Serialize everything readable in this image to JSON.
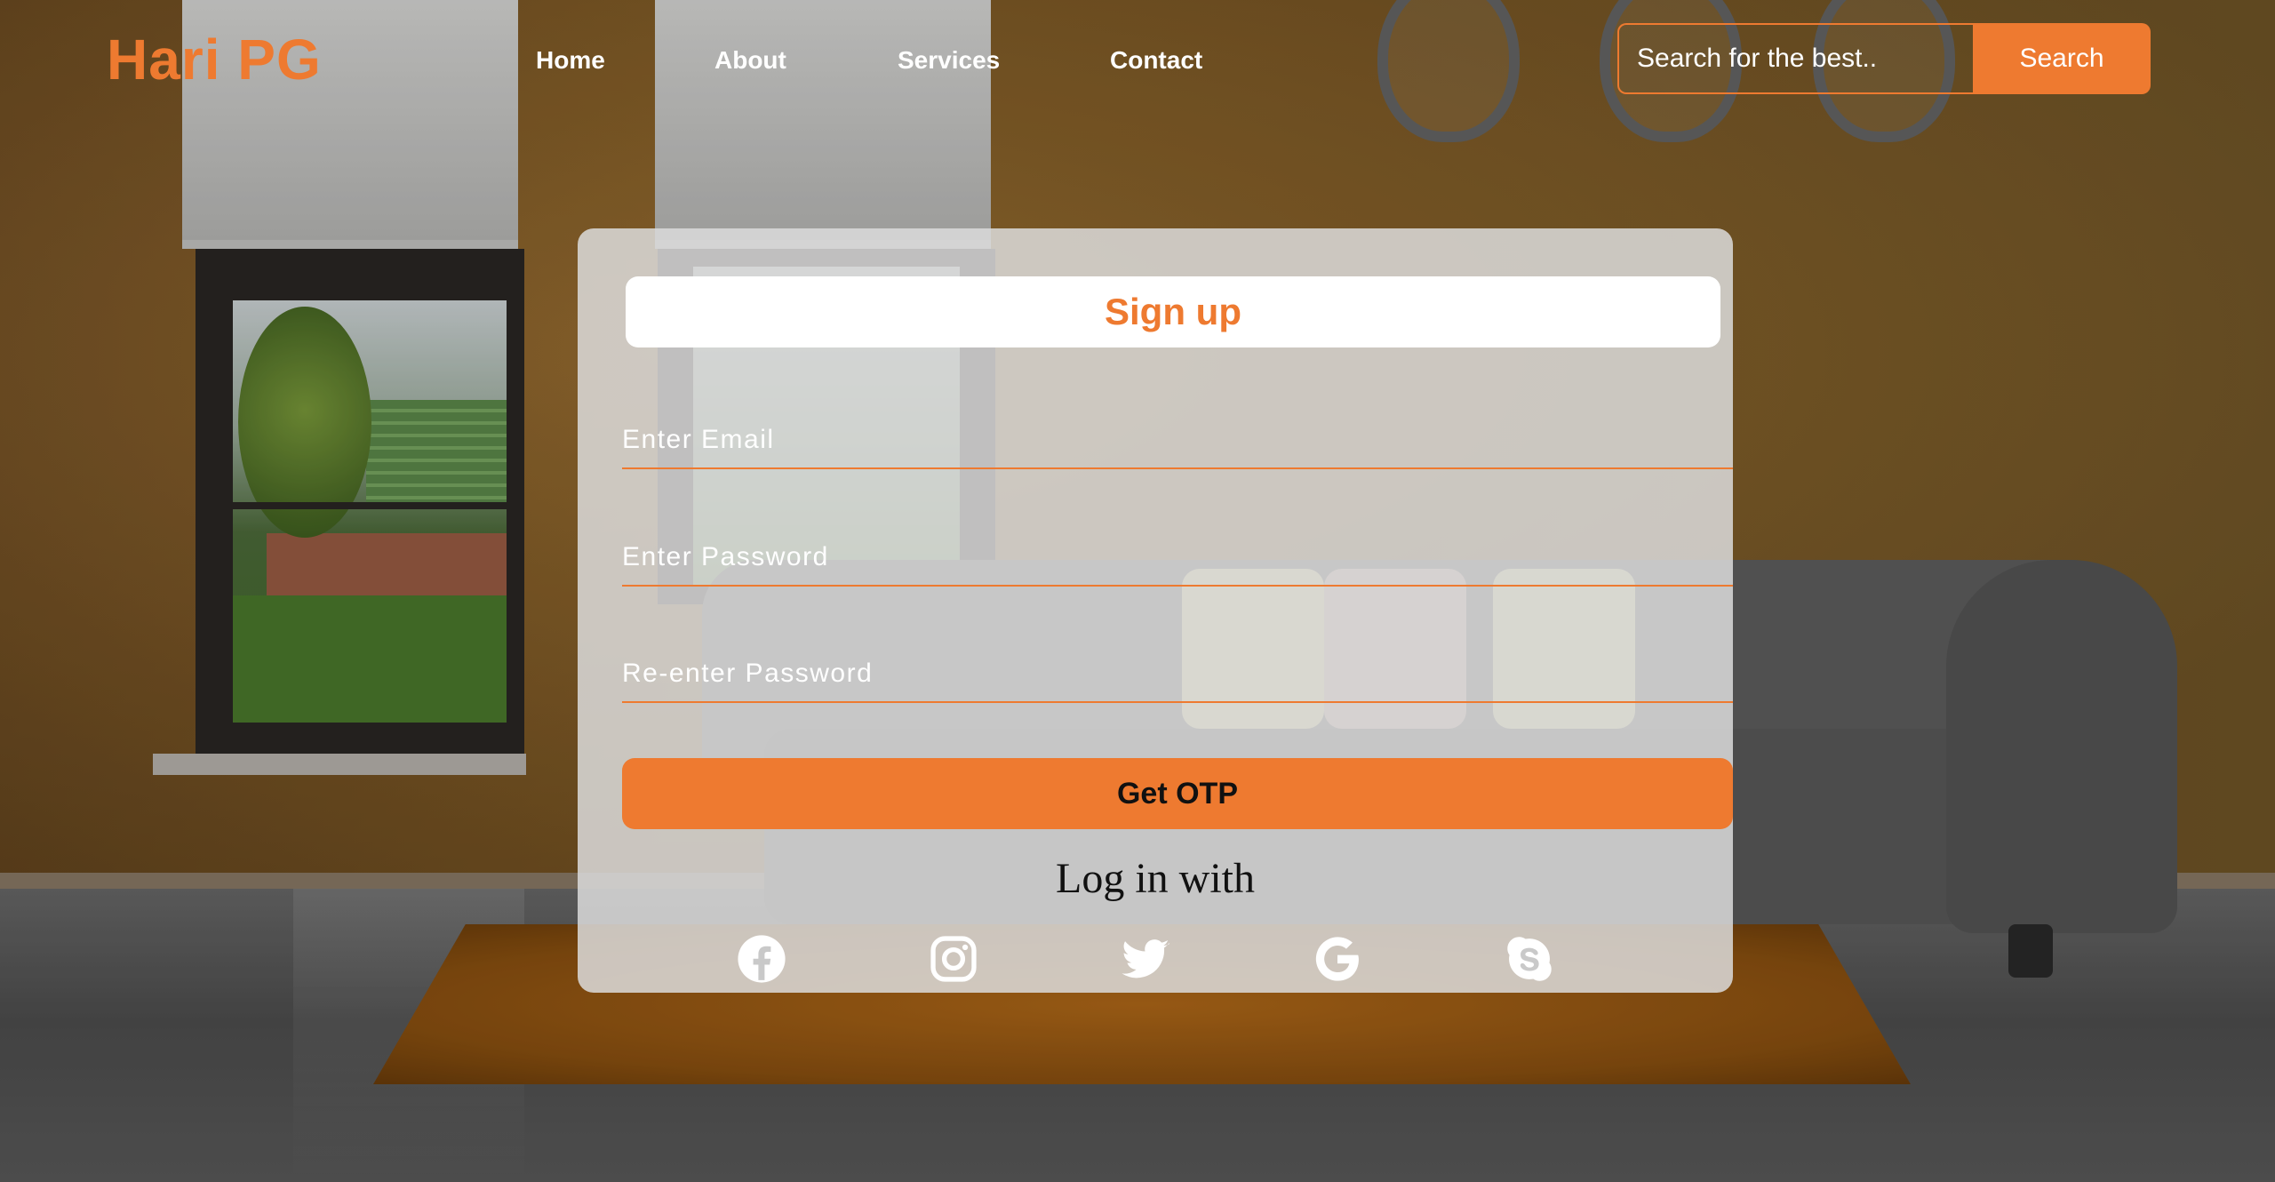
{
  "header": {
    "brand": "Hari PG",
    "nav": [
      {
        "label": "Home"
      },
      {
        "label": "About"
      },
      {
        "label": "Services"
      },
      {
        "label": "Contact"
      }
    ],
    "search": {
      "placeholder": "Search for the best..",
      "button_label": "Search"
    }
  },
  "signup": {
    "title": "Sign up",
    "email_placeholder": "Enter Email",
    "password_placeholder": "Enter Password",
    "reenter_placeholder": "Re-enter Password",
    "otp_button": "Get OTP",
    "login_with": "Log in with",
    "social_icons": [
      "facebook-icon",
      "instagram-icon",
      "twitter-icon",
      "google-icon",
      "skype-icon"
    ]
  },
  "colors": {
    "accent": "#ee7a30",
    "card_bg": "#dcdcdc",
    "text_dark": "#111111",
    "text_light": "#ffffff"
  }
}
